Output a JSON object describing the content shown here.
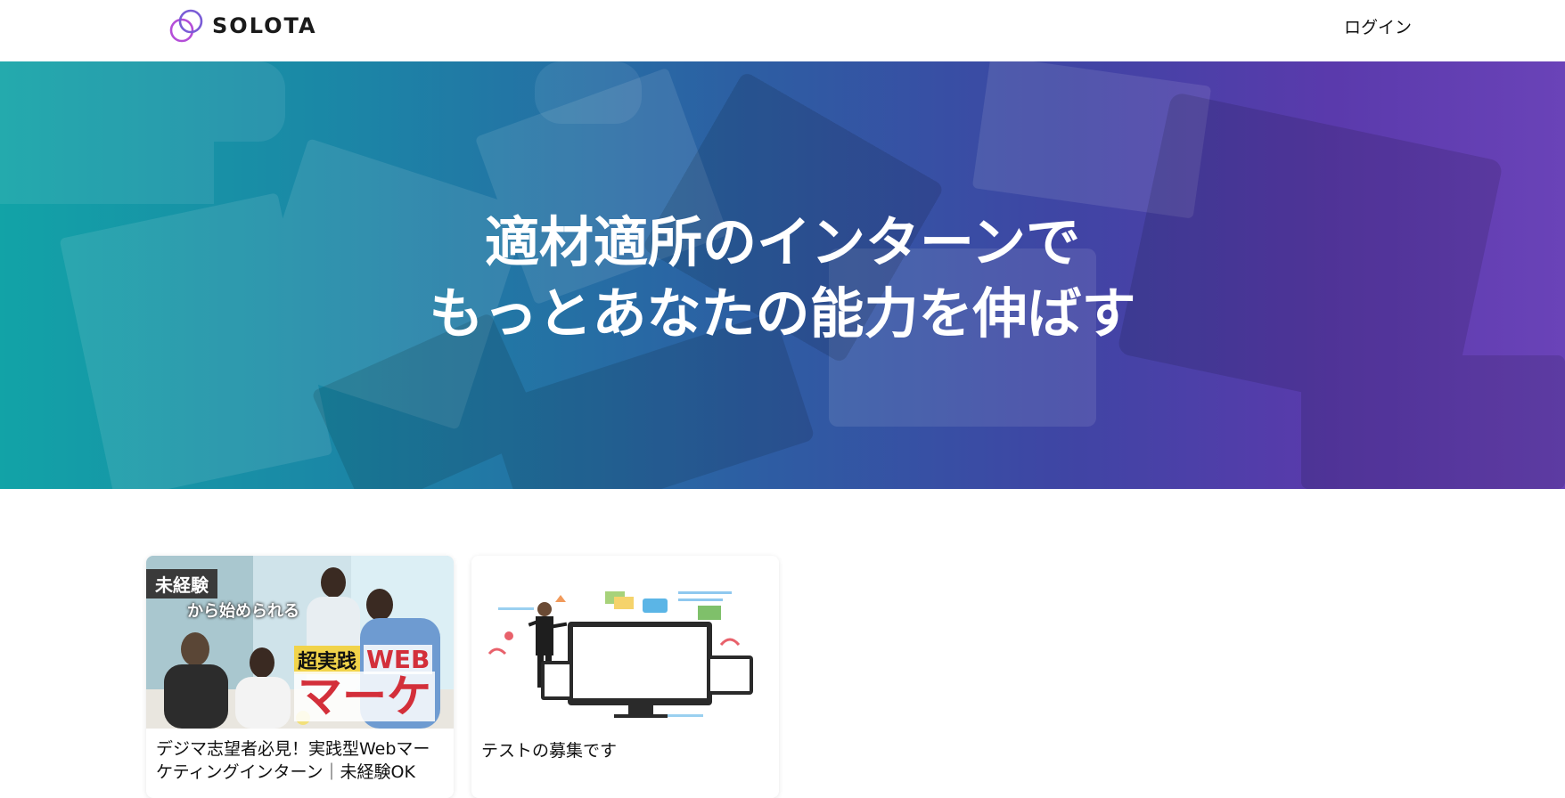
{
  "header": {
    "logo_text": "SOLOTA",
    "login_label": "ログイン"
  },
  "hero": {
    "title_line1": "適材適所のインターンで",
    "title_line2": "もっとあなたの能力を伸ばす"
  },
  "listings": [
    {
      "title": "デジマ志望者必見！実践型Webマーケティングインターン｜未経験OK",
      "thumb_tag": "未経験",
      "thumb_sub": "から始められる",
      "thumb_mid_a": "超実践",
      "thumb_mid_b": "WEB",
      "thumb_big": "マーケ"
    },
    {
      "title": "テストの募集です"
    }
  ],
  "colors": {
    "hero_gradient_left": "#12a3a7",
    "hero_gradient_mid": "#2d5ea3",
    "hero_gradient_right": "#6a43b8",
    "logo_ring_1": "#b44ed8",
    "logo_ring_2": "#7a5cd6"
  },
  "icons": {
    "logo": "interlocking-rings-icon"
  }
}
